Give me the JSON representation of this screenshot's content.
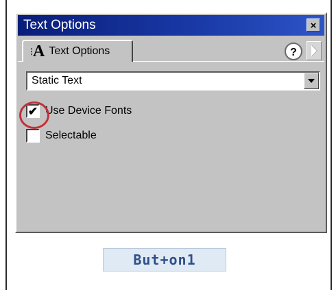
{
  "window": {
    "title": "Text Options",
    "close_symbol": "×"
  },
  "tab": {
    "label": "Text Options",
    "icon": "text-options-icon",
    "icon_glyph": "A"
  },
  "help_button": {
    "label": "?"
  },
  "text_type_select": {
    "selected": "Static Text"
  },
  "options": [
    {
      "label": "Use Device Fonts",
      "checked": true,
      "check_glyph": "✔"
    },
    {
      "label": "Selectable",
      "checked": false
    }
  ],
  "stage": {
    "button_label": "But+on1"
  },
  "colors": {
    "titlebar_start": "#0a1e7a",
    "titlebar_end": "#2d54c6",
    "panel_bg": "#c3c3c3",
    "highlight_circle": "#c2303a",
    "stage_button_text": "#2f4f86"
  }
}
